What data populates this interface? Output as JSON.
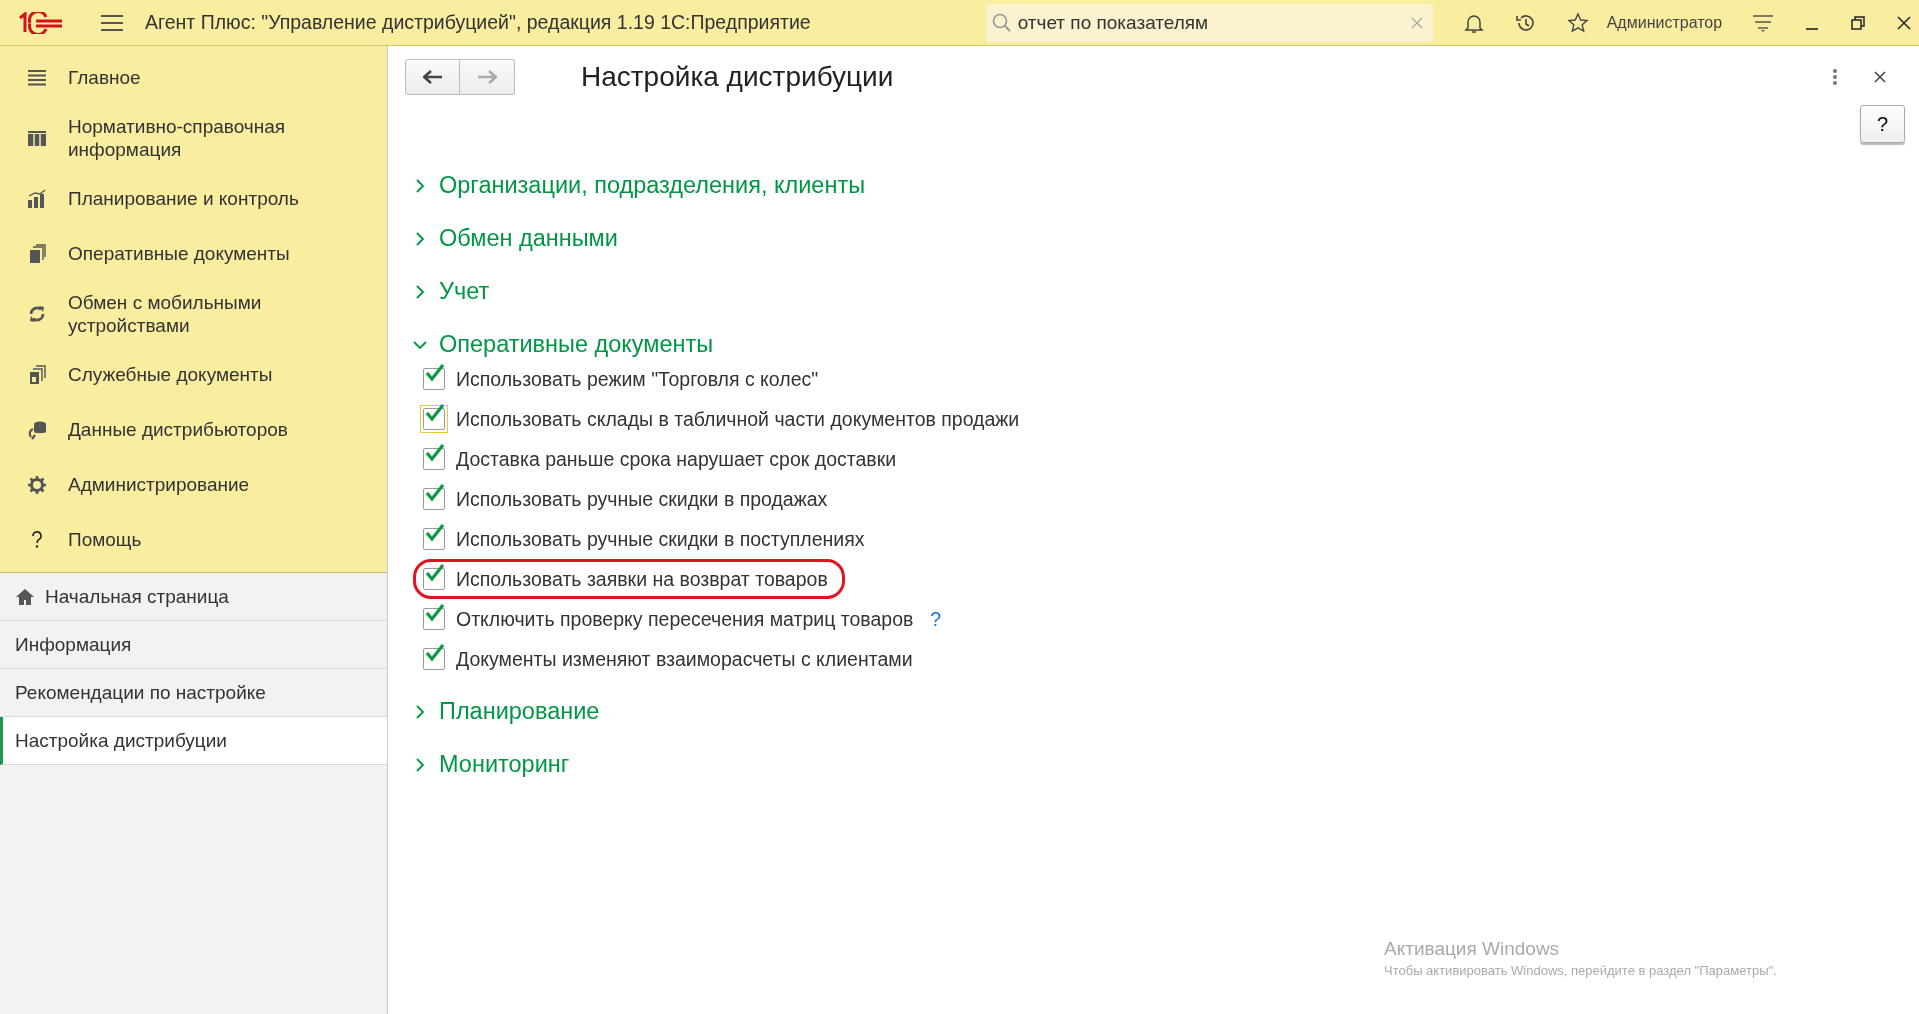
{
  "window": {
    "title": "Агент Плюс: \"Управление дистрибуцией\", редакция 1.19 1С:Предприятие",
    "search": {
      "value": "отчет по показателям"
    },
    "user": "Администратор"
  },
  "sidebar": {
    "sections": [
      {
        "label": "Главное"
      },
      {
        "label": "Нормативно-справочная информация"
      },
      {
        "label": "Планирование и контроль"
      },
      {
        "label": "Оперативные документы"
      },
      {
        "label": "Обмен с мобильными устройствами"
      },
      {
        "label": "Служебные документы"
      },
      {
        "label": "Данные дистрибьюторов"
      },
      {
        "label": "Администрирование"
      },
      {
        "label": "Помощь"
      }
    ],
    "pages": [
      {
        "label": "Начальная страница",
        "selected": false
      },
      {
        "label": "Информация",
        "selected": false
      },
      {
        "label": "Рекомендации по настройке",
        "selected": false
      },
      {
        "label": "Настройка дистрибуции",
        "selected": true
      }
    ]
  },
  "form": {
    "title": "Настройка дистрибуции",
    "help": "?",
    "groups": [
      {
        "label": "Организации, подразделения, клиенты",
        "expanded": false
      },
      {
        "label": "Обмен данными",
        "expanded": false
      },
      {
        "label": "Учет",
        "expanded": false
      },
      {
        "label": "Оперативные документы",
        "expanded": true,
        "options": [
          {
            "label": "Использовать режим \"Торговля с колес\"",
            "checked": true,
            "focused": false,
            "highlighted": false
          },
          {
            "label": "Использовать склады в табличной части документов продажи",
            "checked": true,
            "focused": true,
            "highlighted": false
          },
          {
            "label": "Доставка раньше срока нарушает срок доставки",
            "checked": true,
            "focused": false,
            "highlighted": false
          },
          {
            "label": "Использовать ручные скидки в продажах",
            "checked": true,
            "focused": false,
            "highlighted": false
          },
          {
            "label": "Использовать ручные скидки в поступлениях",
            "checked": true,
            "focused": false,
            "highlighted": false
          },
          {
            "label": "Использовать заявки на возврат товаров",
            "checked": true,
            "focused": false,
            "highlighted": true
          },
          {
            "label": "Отключить проверку пересечения матриц товаров",
            "checked": true,
            "focused": false,
            "highlighted": false,
            "hint": "?"
          },
          {
            "label": "Документы изменяют взаиморасчеты с клиентами",
            "checked": true,
            "focused": false,
            "highlighted": false
          }
        ]
      },
      {
        "label": "Планирование",
        "expanded": false
      },
      {
        "label": "Мониторинг",
        "expanded": false
      }
    ]
  },
  "activation": {
    "title": "Активация Windows",
    "text": "Чтобы активировать Windows, перейдите в раздел \"Параметры\"."
  }
}
